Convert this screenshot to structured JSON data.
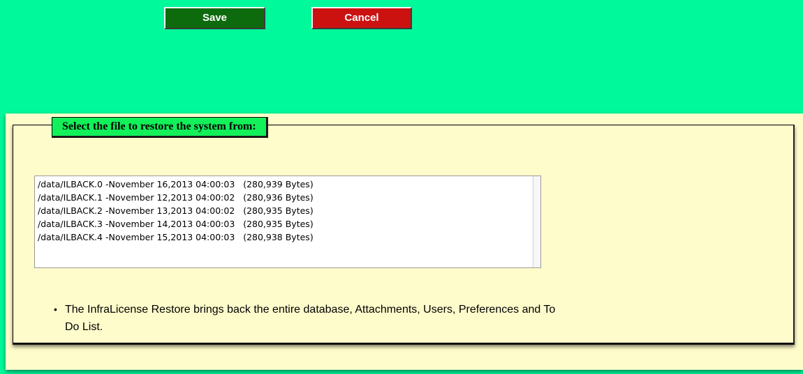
{
  "toolbar": {
    "save_label": "Save",
    "cancel_label": "Cancel"
  },
  "restore": {
    "legend": "Select the file to restore the system from:",
    "files": [
      "/data/ILBACK.0 -November 16,2013 04:00:03   (280,939 Bytes)",
      "/data/ILBACK.1 -November 12,2013 04:00:02   (280,936 Bytes)",
      "/data/ILBACK.2 -November 13,2013 04:00:02   (280,935 Bytes)",
      "/data/ILBACK.3 -November 14,2013 04:00:03   (280,935 Bytes)",
      "/data/ILBACK.4 -November 15,2013 04:00:03   (280,938 Bytes)"
    ],
    "note_bullet": "•",
    "note": "The InfraLicense Restore brings back the entire database, Attachments, Users, Preferences and To Do List."
  },
  "colors": {
    "page_background": "#00f99a",
    "save_button": "#0d6a0d",
    "cancel_button": "#cc1111",
    "panel_background": "#fffccb",
    "legend_background": "#12f05a"
  }
}
